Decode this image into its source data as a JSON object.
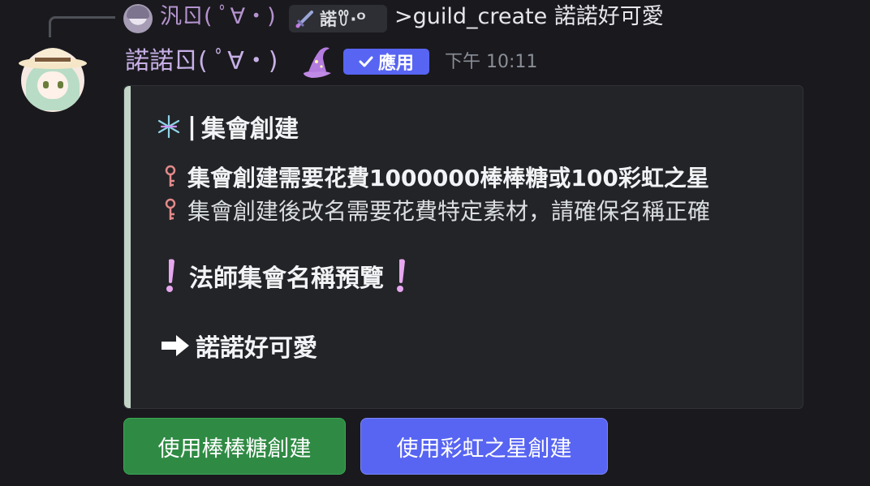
{
  "reply": {
    "author_name": "汎ㄖ( ﾟ∀・)",
    "tag_text": "諾ꀎ·ᴼ",
    "content": ">guild_create 諾諾好可愛",
    "tag_icon": "sword-icon"
  },
  "message": {
    "author_name": "諾諾ㄖ( ﾟ∀・)",
    "author_emoji": "wizard-hat-icon",
    "app_badge_label": "應用",
    "timestamp": "下午 10:11"
  },
  "embed": {
    "accent_color": "#c2d4c6",
    "title_prefix": "|",
    "title": "集會創建",
    "line1": "集會創建需要花費1000000棒棒糖或100彩虹之星",
    "line2": "集會創建後改名需要花費特定素材，請確保名稱正確",
    "heading": "法師集會名稱預覽",
    "guild_name": "諾諾好可愛"
  },
  "buttons": {
    "candy_label": "使用棒棒糖創建",
    "rainbow_label": "使用彩虹之星創建",
    "candy_color": "#2f8a43",
    "rainbow_color": "#5865f2"
  }
}
